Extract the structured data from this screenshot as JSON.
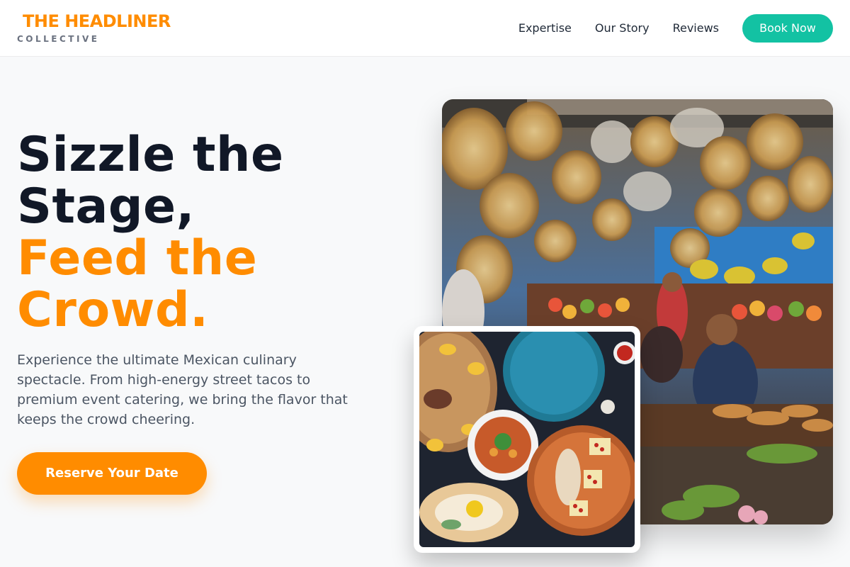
{
  "brand": {
    "name": "THE HEADLINER",
    "tagline": "COLLECTIVE",
    "accent_color": "#ff8c00",
    "teal_color": "#13c2a3"
  },
  "nav": {
    "items": [
      "Expertise",
      "Our Story",
      "Reviews"
    ],
    "cta_label": "Book Now"
  },
  "hero": {
    "title_line1": "Sizzle the",
    "title_line2": "Stage,",
    "title_line3": "Feed the",
    "title_line4": "Crowd.",
    "description": "Experience the ultimate Mexican culinary spectacle. From high-energy street tacos to premium event catering, we bring the flavor that keeps the crowd cheering.",
    "cta_label": "Reserve Your Date"
  },
  "images": {
    "main_alt": "market-stall-photo",
    "secondary_alt": "mexican-food-platter-photo"
  }
}
